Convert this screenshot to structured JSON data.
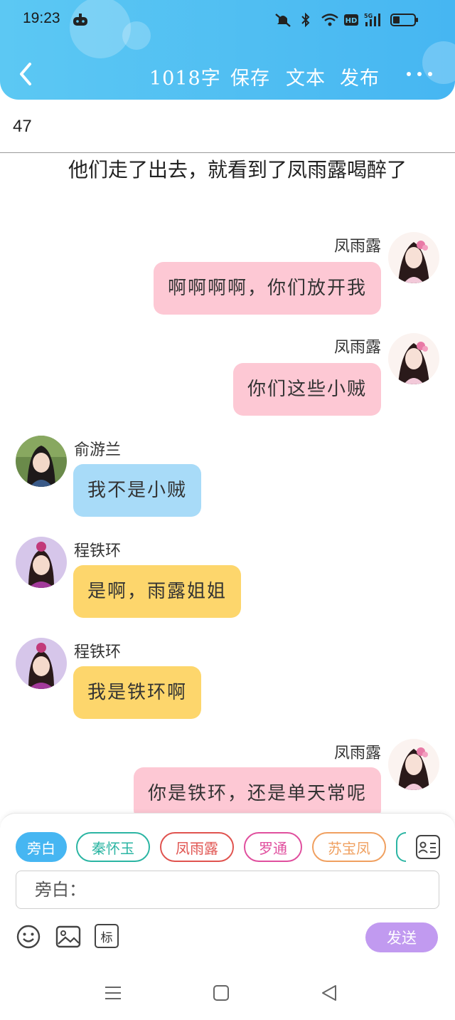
{
  "status": {
    "time": "19:23"
  },
  "toolbar": {
    "word_count": "1018字",
    "save_label": "保存",
    "text_label": "文本",
    "publish_label": "发布"
  },
  "chapter": {
    "number": "47"
  },
  "narration": "他们走了出去，就看到了凤雨露喝醉了",
  "messages": [
    {
      "speaker": "凤雨露",
      "text": "啊啊啊啊，你们放开我",
      "side": "right",
      "color": "#fdc8d4"
    },
    {
      "speaker": "凤雨露",
      "text": "你们这些小贼",
      "side": "right",
      "color": "#fdc8d4"
    },
    {
      "speaker": "俞游兰",
      "text": "我不是小贼",
      "side": "left",
      "color": "#a8dbf8"
    },
    {
      "speaker": "程铁环",
      "text": "是啊，雨露姐姐",
      "side": "left",
      "color": "#fdd66c"
    },
    {
      "speaker": "程铁环",
      "text": "我是铁环啊",
      "side": "left",
      "color": "#fdd66c"
    },
    {
      "speaker": "凤雨露",
      "text": "你是铁环，还是单天常呢",
      "side": "right",
      "color": "#fdc8d4"
    }
  ],
  "roles": [
    {
      "label": "旁白",
      "color": "#46b6f2"
    },
    {
      "label": "秦怀玉",
      "color": "#2bb5a3"
    },
    {
      "label": "凤雨露",
      "color": "#e0534f"
    },
    {
      "label": "罗通",
      "color": "#e04f9e"
    },
    {
      "label": "苏宝凤",
      "color": "#f0a060"
    }
  ],
  "input": {
    "placeholder": "旁白："
  },
  "tools": {
    "tag_label": "标"
  },
  "send_label": "发送"
}
